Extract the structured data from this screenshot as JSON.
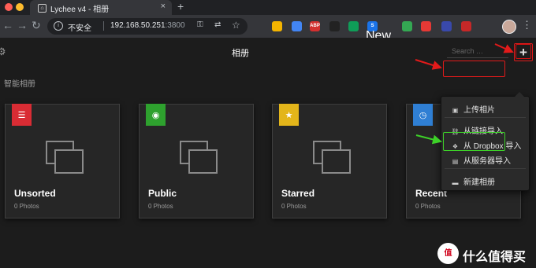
{
  "browser": {
    "tab_title": "Lychee v4 - 相册",
    "tab_icon": "lychee-favicon",
    "insecure_label": "不安全",
    "url_host": "192.168.50.251",
    "url_port": ":3800",
    "extensions": [
      {
        "name": "ext-yellow",
        "color": "#f4b400",
        "label": ""
      },
      {
        "name": "ext-blue",
        "color": "#4285f4",
        "label": ""
      },
      {
        "name": "ext-abp",
        "color": "#d32f2f",
        "label": "ABP"
      },
      {
        "name": "ext-dark",
        "color": "#222222",
        "label": ""
      },
      {
        "name": "ext-green",
        "color": "#0f9d58",
        "label": ""
      },
      {
        "name": "ext-new",
        "color": "#1a73e8",
        "label": "S",
        "badge": "New"
      },
      {
        "name": "ext-multicolor",
        "color": "#34a853",
        "label": ""
      },
      {
        "name": "ext-red-check",
        "color": "#e53935",
        "label": ""
      },
      {
        "name": "ext-blue2",
        "color": "#3949ab",
        "label": ""
      },
      {
        "name": "ext-red2",
        "color": "#c62828",
        "label": ""
      }
    ]
  },
  "app": {
    "page_title": "相册",
    "search_placeholder": "Search …",
    "section_title": "智能相册",
    "albums": [
      {
        "name": "Unsorted",
        "count": "0 Photos",
        "badge_color": "#d92c34",
        "badge_icon": "list-icon",
        "badge_glyph": "☰"
      },
      {
        "name": "Public",
        "count": "0 Photos",
        "badge_color": "#2ea12e",
        "badge_icon": "eye-icon",
        "badge_glyph": "◉"
      },
      {
        "name": "Starred",
        "count": "0 Photos",
        "badge_color": "#e3b51a",
        "badge_icon": "star-icon",
        "badge_glyph": "★"
      },
      {
        "name": "Recent",
        "count": "0 Photos",
        "badge_color": "#2f7fd4",
        "badge_icon": "clock-icon",
        "badge_glyph": "◷"
      }
    ],
    "add_menu": {
      "upload_photo": "上传相片",
      "import_link": "从链接导入",
      "import_dropbox": "从 Dropbox 导入",
      "import_server": "从服务器导入",
      "new_album": "新建相册"
    }
  },
  "annotations": {
    "red_color": "#e21a1a",
    "green_color": "#3dd128"
  },
  "watermark": {
    "logo_text": "值",
    "text": "什么值得买"
  }
}
